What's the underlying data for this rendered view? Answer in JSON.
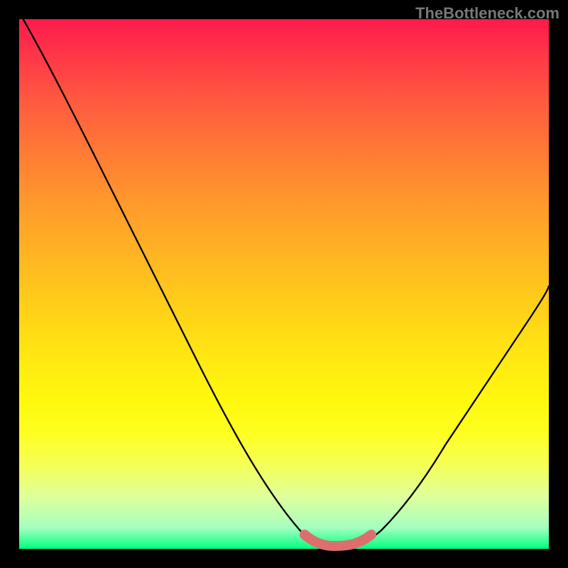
{
  "watermark": "TheBottleneck.com",
  "chart_data": {
    "type": "line",
    "title": "",
    "xlabel": "",
    "ylabel": "",
    "xlim": [
      0,
      100
    ],
    "ylim": [
      0,
      100
    ],
    "x": [
      0,
      6,
      12,
      18,
      24,
      30,
      36,
      42,
      48,
      53,
      56,
      59,
      62,
      65,
      70,
      75,
      80,
      86,
      92,
      100
    ],
    "values": [
      100,
      88,
      76,
      64,
      53,
      42,
      32,
      22,
      13,
      6,
      3,
      1.5,
      1.5,
      3,
      7,
      13,
      21,
      30,
      40,
      55
    ],
    "annotations": [
      {
        "xrange": [
          54,
          66
        ],
        "color": "#dd6e6e",
        "note": "optimal zone marker"
      }
    ],
    "colors": {
      "curve": "#000000",
      "marker": "#dd6e6e",
      "gradient_top": "#ff1a4a",
      "gradient_bottom": "#00ff80",
      "background": "#000000"
    }
  }
}
